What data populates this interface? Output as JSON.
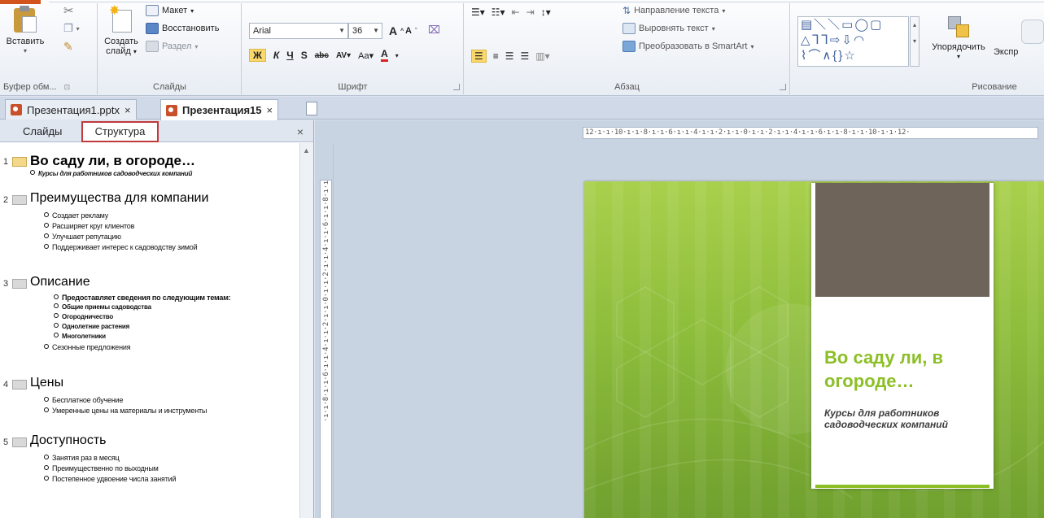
{
  "ribbon": {
    "clipboard": {
      "paste_label": "Вставить",
      "group_label": "Буфер обм...",
      "group_launcher": "⊡"
    },
    "slides": {
      "new_slide_label_1": "Создать",
      "new_slide_label_2": "слайд",
      "layout_label": "Макет",
      "reset_label": "Восстановить",
      "section_label": "Раздел",
      "group_label": "Слайды"
    },
    "font": {
      "font_name": "Arial",
      "font_size": "36",
      "group_label": "Шрифт"
    },
    "paragraph": {
      "text_direction_label": "Направление текста",
      "align_text_label": "Выровнять текст",
      "smartart_label": "Преобразовать в SmartArt",
      "group_label": "Абзац"
    },
    "drawing": {
      "arrange_label": "Упорядочить",
      "express_styles_label": "Экспр",
      "group_label": "Рисование"
    }
  },
  "doc_tabs": [
    {
      "label": "Презентация1.pptx",
      "close": "×"
    },
    {
      "label": "Презентация15",
      "close": "×"
    }
  ],
  "pane": {
    "tab_slides": "Слайды",
    "tab_outline": "Структура",
    "close": "×"
  },
  "outline": [
    {
      "num": "1",
      "title": "Во саду ли, в огороде…",
      "subtitle": "Курсы для работников садоводческих компаний"
    },
    {
      "num": "2",
      "title": "Преимущества для компании",
      "bullets": [
        "Создает рекламу",
        "Расширяет круг клиентов",
        "Улучшает репутацию",
        "Поддерживает интерес к садоводству зимой"
      ]
    },
    {
      "num": "3",
      "title": "Описание",
      "sub_heading": "Предоставляет сведения по следующим темам:",
      "sub_bullets": [
        "Общие приемы садоводства",
        "Огородничество",
        "Однолетние растения",
        "Многолетники"
      ],
      "bullets": [
        "Сезонные предложения"
      ]
    },
    {
      "num": "4",
      "title": "Цены",
      "bullets": [
        "Бесплатное обучение",
        "Умеренные цены на материалы и инструменты"
      ]
    },
    {
      "num": "5",
      "title": "Доступность",
      "bullets": [
        "Занятия раз в месяц",
        "Преимущественно по выходным",
        "Постепенное удвоение числа занятий"
      ]
    }
  ],
  "rulers": {
    "horizontal": "12·ı·ı·10·ı·ı·8·ı·ı·6·ı·ı·4·ı·ı·2·ı·ı·0·ı·ı·2·ı·ı·4·ı·ı·6·ı·ı·8·ı·ı·10·ı·ı·12·",
    "vertical": "·ı·ı·8·ı·ı·6·ı·ı·4·ı·ı·2·ı·ı·0·ı·ı·2·ı·ı·4·ı·ı·6·ı·ı·8·ı·ı"
  },
  "slide": {
    "title": "Во саду ли, в огороде…",
    "subtitle": "Курсы для работников садоводческих компаний",
    "accent_color": "#8cbf26",
    "photo_color": "#6f6459"
  }
}
